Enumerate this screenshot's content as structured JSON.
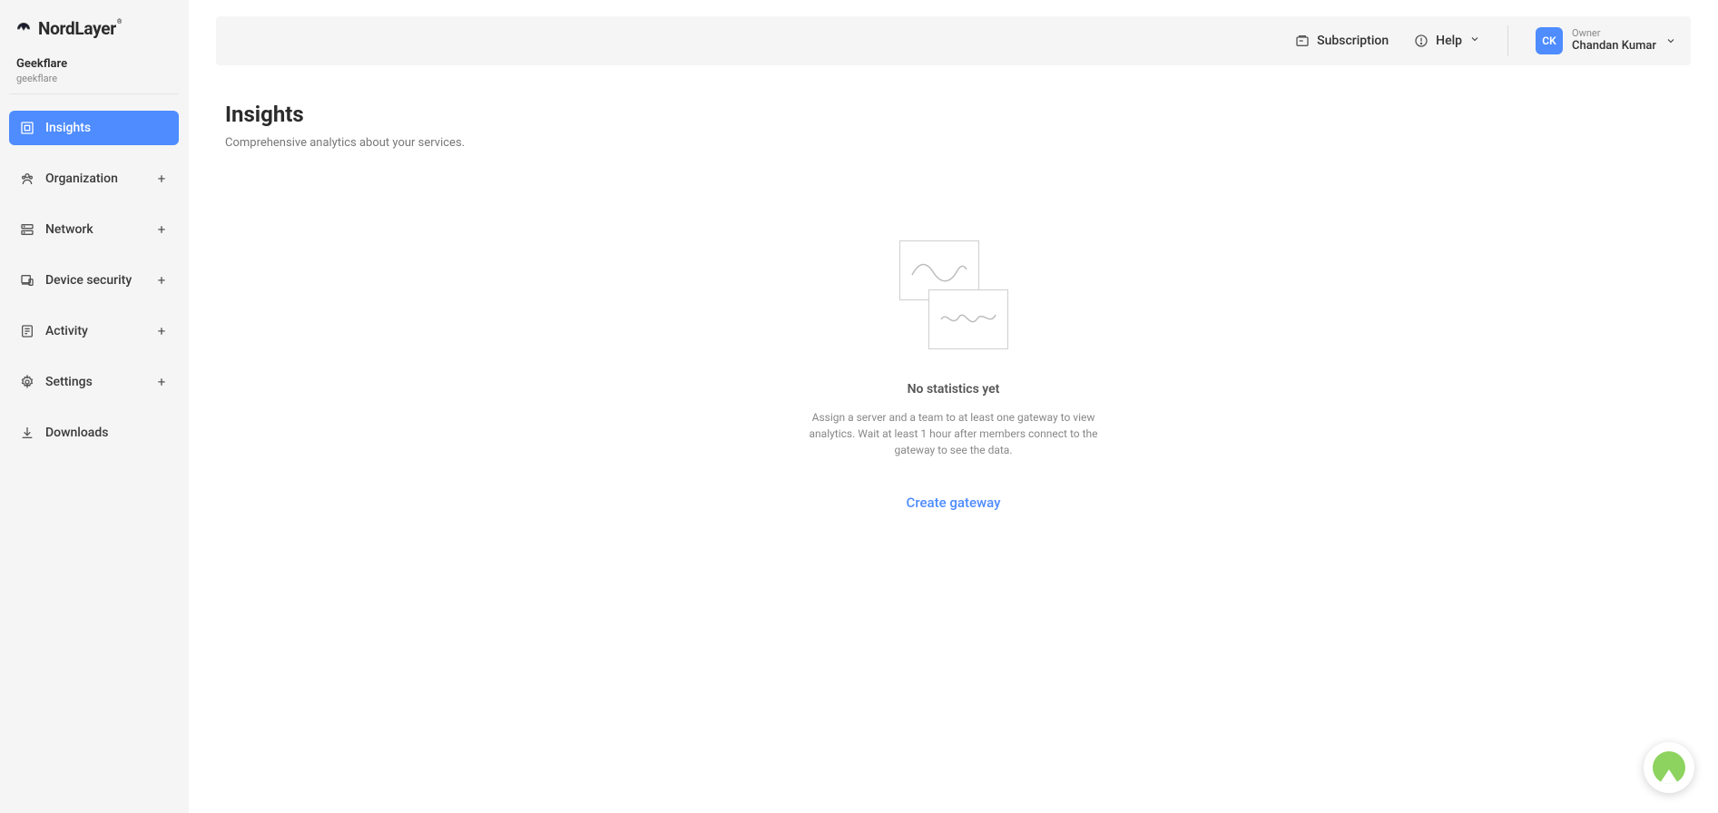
{
  "brand": {
    "name": "NordLayer"
  },
  "org": {
    "name": "Geekflare",
    "slug": "geekflare"
  },
  "sidebar": {
    "items": [
      {
        "label": "Insights",
        "expandable": false,
        "active": true
      },
      {
        "label": "Organization",
        "expandable": true,
        "active": false
      },
      {
        "label": "Network",
        "expandable": true,
        "active": false
      },
      {
        "label": "Device security",
        "expandable": true,
        "active": false
      },
      {
        "label": "Activity",
        "expandable": true,
        "active": false
      },
      {
        "label": "Settings",
        "expandable": true,
        "active": false
      },
      {
        "label": "Downloads",
        "expandable": false,
        "active": false
      }
    ]
  },
  "topbar": {
    "subscription_label": "Subscription",
    "help_label": "Help"
  },
  "user": {
    "initials": "CK",
    "role": "Owner",
    "name": "Chandan Kumar"
  },
  "page": {
    "title": "Insights",
    "subtitle": "Comprehensive analytics about your services."
  },
  "empty": {
    "title": "No statistics yet",
    "text": "Assign a server and a team to at least one gateway to view analytics. Wait at least 1 hour after members connect to the gateway to see the data.",
    "cta": "Create gateway"
  }
}
